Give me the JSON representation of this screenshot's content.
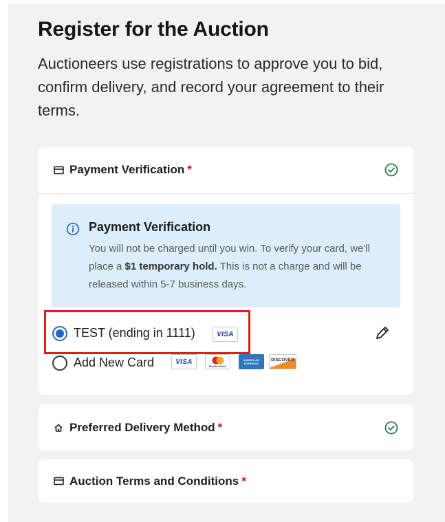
{
  "header": {
    "title": "Register for the Auction",
    "intro": "Auctioneers use registrations to approve you to bid, confirm delivery, and record your agreement to their terms."
  },
  "sections": {
    "payment": {
      "title": "Payment Verification",
      "required_mark": "*",
      "complete": true,
      "icon": "credit-card-icon"
    },
    "delivery": {
      "title": "Preferred Delivery Method",
      "required_mark": "*",
      "complete": true,
      "icon": "house-icon"
    },
    "terms": {
      "title": "Auction Terms and Conditions",
      "required_mark": "*",
      "complete": false,
      "icon": "credit-card-icon"
    }
  },
  "info": {
    "title": "Payment Verification",
    "text_before": "You will not be charged until you win. To verify your card, we'll place a ",
    "text_bold": "$1 temporary hold.",
    "text_after": " This is not a charge and will be released within 5-7 business days."
  },
  "payment_options": [
    {
      "label": "TEST (ending in 1111)",
      "selected": true,
      "brand": "VISA"
    },
    {
      "label": "Add New Card",
      "selected": false
    }
  ],
  "card_brands": {
    "visa": "VISA",
    "mastercard": "MasterCard",
    "amex": "AMERICAN EXPRESS",
    "discover": "DISCOVER"
  },
  "colors": {
    "accent_blue": "#2466c9",
    "success_green": "#2e7d4f",
    "required_red": "#d0102a",
    "info_bg": "#ddeefb",
    "highlight_red": "#e21b1b"
  }
}
